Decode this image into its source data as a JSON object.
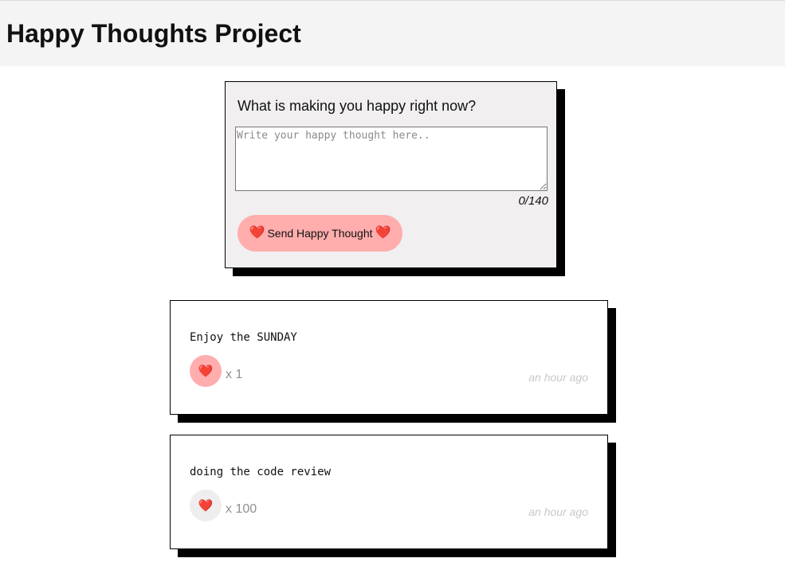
{
  "header": {
    "title": "Happy Thoughts Project"
  },
  "form": {
    "question": "What is making you happy right now?",
    "placeholder": "Write your happy thought here..",
    "value": "",
    "counter": "0/140",
    "send_label": "Send Happy Thought",
    "heart_glyph": "❤️"
  },
  "thoughts": [
    {
      "message": "Enjoy the SUNDAY",
      "likes": "x 1",
      "time": "an hour ago",
      "liked": true,
      "like_bg": "#ffadad"
    },
    {
      "message": "doing the code review",
      "likes": "x 100",
      "time": "an hour ago",
      "liked": false,
      "like_bg": "#eeeeee"
    }
  ],
  "colors": {
    "header_bg": "#f4f4f4",
    "form_bg": "#f1eff0",
    "accent_pink": "#ffadad",
    "heart_red": "#e0192d",
    "shadow": "#000000"
  },
  "icons": {
    "heart": "heart-icon"
  }
}
